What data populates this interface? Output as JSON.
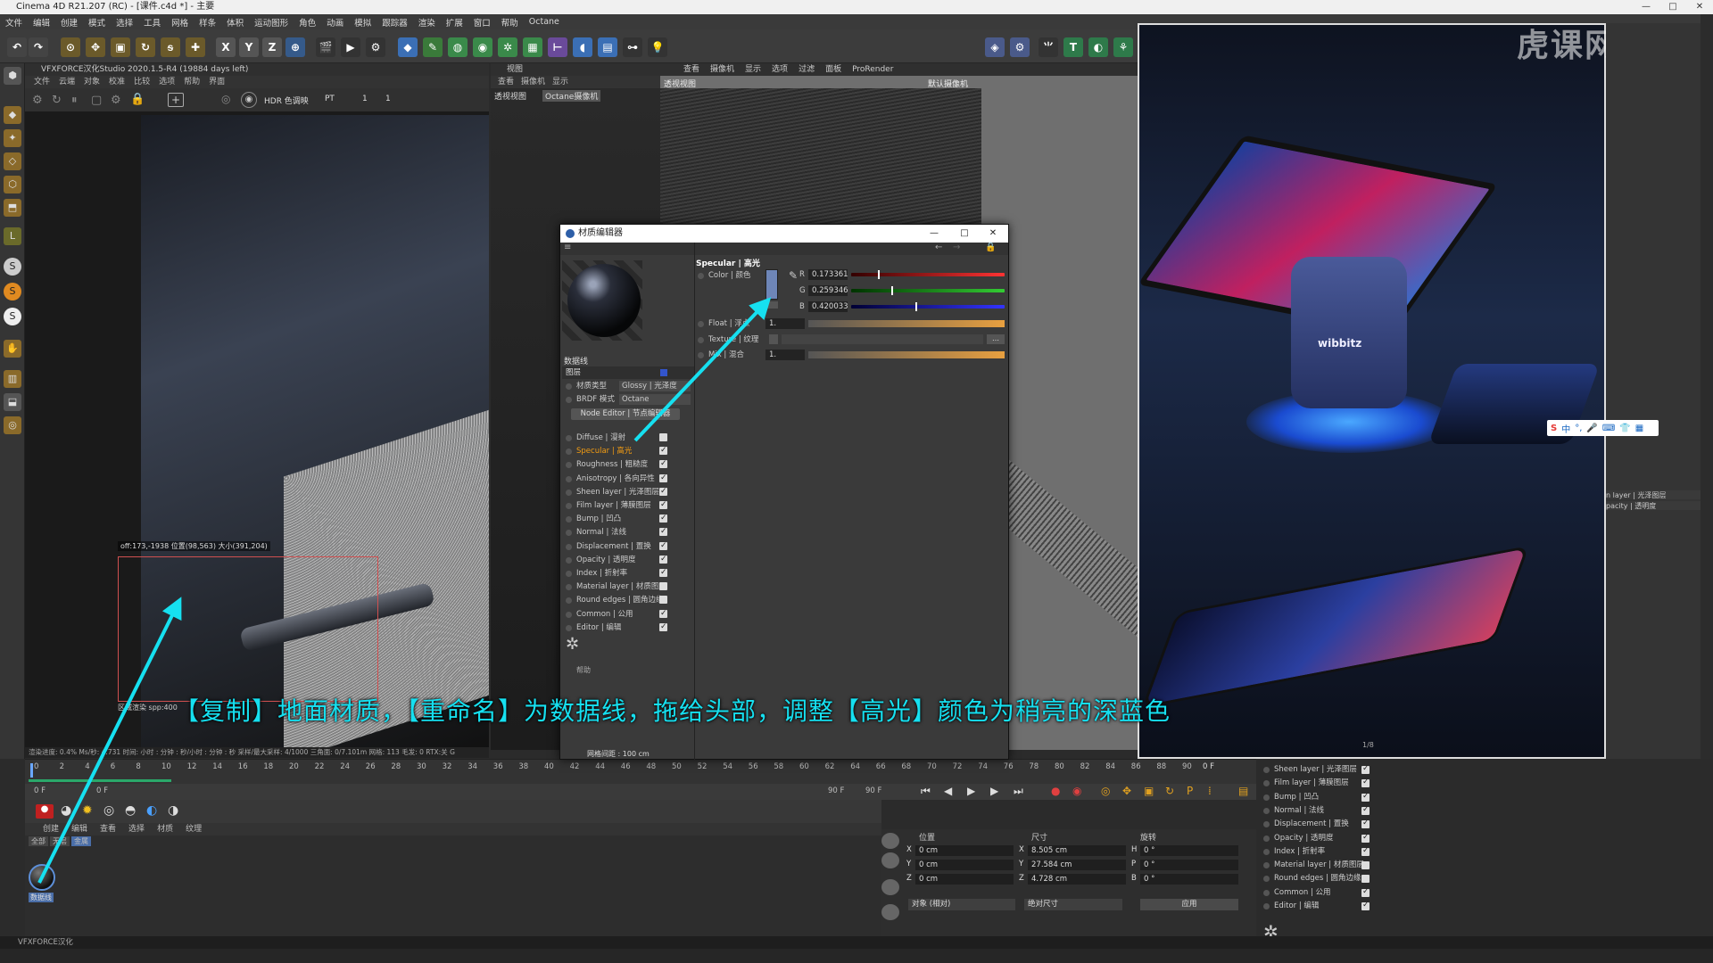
{
  "window": {
    "title": "Cinema 4D R21.207 (RC) - [课件.c4d *] - 主要",
    "controls": [
      "—",
      "□",
      "✕"
    ]
  },
  "menubar": [
    "文件",
    "编辑",
    "创建",
    "模式",
    "选择",
    "工具",
    "网格",
    "样条",
    "体积",
    "运动图形",
    "角色",
    "动画",
    "模拟",
    "跟踪器",
    "渲染",
    "扩展",
    "窗口",
    "帮助",
    "Octane"
  ],
  "toolbar": {
    "axis_buttons": [
      "X",
      "Y",
      "Z"
    ]
  },
  "left_viewport": {
    "title": "VFXFORCE汉化Studio 2020.1.5-R4 (19884 days left)",
    "menus": [
      "文件",
      "云端",
      "对象",
      "校准",
      "比较",
      "选项",
      "帮助",
      "界面"
    ],
    "hdr_mode": "HDR 色调映",
    "pt_mode": "PT",
    "field1": "1",
    "field2": "1",
    "selection_info": "off:173,-1938 位置(98,563) 大小(391,204)",
    "region_info": "区域渲染 spp:400",
    "status": "渲染进度: 0.4%   Ms/秒: 4.731   时间: 小时 : 分钟 : 秒/小时 : 分钟 : 秒   采样/最大采样: 4/1000   三角面: 0/7.101m   网格: 113   毛发: 0   RTX:关   G"
  },
  "mid_viewport": {
    "title": "视图",
    "menus": [
      "查看",
      "摄像机",
      "显示"
    ],
    "label1": "透视视图",
    "label2": "Octane摄像机"
  },
  "right_viewport": {
    "menus": [
      "查看",
      "摄像机",
      "显示",
      "选项",
      "过滤",
      "面板",
      "ProRender"
    ],
    "label_left": "透视视图",
    "label_right": "默认摄像机",
    "grid_info": "网格间距 : 100 cm"
  },
  "material_editor": {
    "window_title": "材质编辑器",
    "material_name": "数据线",
    "tab_label": "图层",
    "material_type_label": "材质类型",
    "material_type_value": "Glossy | 光泽度",
    "brdf_label": "BRDF 模式",
    "brdf_value": "Octane",
    "node_editor": "Node Editor | 节点编辑器",
    "channels": [
      {
        "label": "Diffuse | 漫射",
        "checked": false,
        "active": false
      },
      {
        "label": "Specular | 高光",
        "checked": true,
        "active": true
      },
      {
        "label": "Roughness | 粗糙度",
        "checked": true,
        "active": false
      },
      {
        "label": "Anisotropy | 各向异性",
        "checked": true,
        "active": false
      },
      {
        "label": "Sheen layer | 光泽图层",
        "checked": true,
        "active": false
      },
      {
        "label": "Film layer | 薄膜图层",
        "checked": true,
        "active": false
      },
      {
        "label": "Bump | 凹凸",
        "checked": true,
        "active": false
      },
      {
        "label": "Normal | 法线",
        "checked": true,
        "active": false
      },
      {
        "label": "Displacement | 置换",
        "checked": true,
        "active": false
      },
      {
        "label": "Opacity | 透明度",
        "checked": true,
        "active": false
      },
      {
        "label": "Index | 折射率",
        "checked": true,
        "active": false
      },
      {
        "label": "Material layer | 材质图层",
        "checked": false,
        "active": false
      },
      {
        "label": "Round edges | 圆角边缘",
        "checked": false,
        "active": false
      },
      {
        "label": "Common | 公用",
        "checked": true,
        "active": false
      },
      {
        "label": "Editor | 编辑",
        "checked": true,
        "active": false
      }
    ],
    "help_label": "帮助",
    "section_title": "Specular | 高光",
    "color_label": "Color | 颜色",
    "swatch_color": "#6e86b8",
    "r_label": "R",
    "r_value": "0.173361",
    "g_label": "G",
    "g_value": "0.259346",
    "b_label": "B",
    "b_value": "0.420033",
    "r_fraction": 0.173361,
    "g_fraction": 0.259346,
    "b_fraction": 0.420033,
    "float_label": "Float | 浮点",
    "float_value": "1.",
    "texture_label": "Texture | 纹理",
    "mix_label": "Mix | 混合",
    "mix_value": "1."
  },
  "timeline": {
    "ticks": [
      "0",
      "2",
      "4",
      "6",
      "8",
      "10",
      "12",
      "14",
      "16",
      "18",
      "20",
      "22",
      "24",
      "26",
      "28",
      "30",
      "32",
      "34",
      "36",
      "38",
      "40",
      "42",
      "44",
      "46",
      "48",
      "50",
      "52",
      "54",
      "56",
      "58",
      "60",
      "62",
      "64",
      "66",
      "68",
      "70",
      "72",
      "74",
      "76",
      "78",
      "80",
      "82",
      "84",
      "86",
      "88",
      "90"
    ],
    "current_frame": "0 F",
    "start": "0 F",
    "start2": "0 F",
    "end": "90 F",
    "end2": "90 F"
  },
  "material_manager": {
    "menus": [
      "创建",
      "编辑",
      "查看",
      "选择",
      "材质",
      "纹理"
    ],
    "tabs": [
      "全部",
      "无层",
      "金属"
    ],
    "material_name": "数据线"
  },
  "coordinates": {
    "position_label": "位置",
    "size_label": "尺寸",
    "rotation_label": "旋转",
    "rows": [
      {
        "axis": "X",
        "pos": "0 cm",
        "size_axis": "X",
        "size": "8.505 cm",
        "rot_axis": "H",
        "rot": "0 °"
      },
      {
        "axis": "Y",
        "pos": "0 cm",
        "size_axis": "Y",
        "size": "27.584 cm",
        "rot_axis": "P",
        "rot": "0 °"
      },
      {
        "axis": "Z",
        "pos": "0 cm",
        "size_axis": "Z",
        "size": "4.728 cm",
        "rot_axis": "B",
        "rot": "0 °"
      }
    ],
    "mode": "对象 (相对)",
    "size_mode": "绝对尺寸",
    "apply": "应用"
  },
  "side_layers": [
    {
      "label": "Sheen layer | 光泽图层",
      "checked": true
    },
    {
      "label": "Film layer | 薄膜图层",
      "checked": true
    },
    {
      "label": "Bump | 凹凸",
      "checked": true
    },
    {
      "label": "Normal | 法线",
      "checked": true
    },
    {
      "label": "Displacement | 置换",
      "checked": true
    },
    {
      "label": "Opacity | 透明度",
      "checked": true
    },
    {
      "label": "Index | 折射率",
      "checked": true
    },
    {
      "label": "Material layer | 材质图层",
      "checked": false
    },
    {
      "label": "Round edges | 圆角边缘",
      "checked": false
    },
    {
      "label": "Common | 公用",
      "checked": true
    },
    {
      "label": "Editor | 编辑",
      "checked": true
    }
  ],
  "right_panel": {
    "row1": "n layer | 光泽图层",
    "row2": "pacity | 透明度"
  },
  "reference_photo": {
    "brand": "wibbitz",
    "page": "1/8"
  },
  "ime_bar": {
    "label": "中"
  },
  "watermark": "虎课网",
  "bottom_bar": "VFXFORCE汉化",
  "subtitle": "【复制】地面材质，【重命名】为数据线，拖给头部，调整【高光】颜色为稍亮的深蓝色",
  "colors": {
    "accent_cyan": "#16e0f0",
    "active_orange": "#f39c12",
    "panel_bg": "#3a3a3a"
  }
}
